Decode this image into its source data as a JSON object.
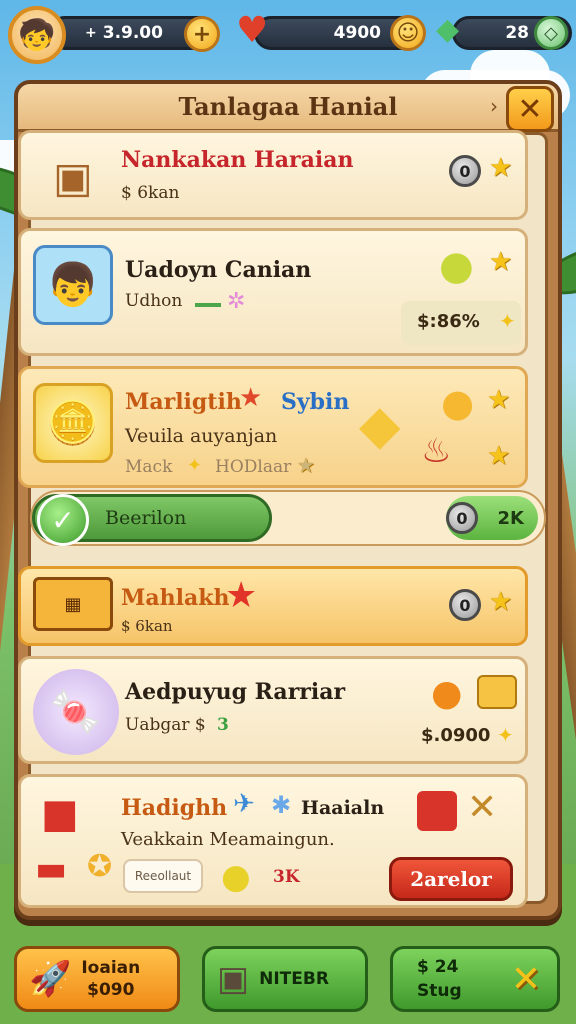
{
  "hud": {
    "coins": "3.9.00",
    "hearts": "4900",
    "gems": "28"
  },
  "panel": {
    "title": "Tanlagaa Hanial"
  },
  "rows": [
    {
      "title": "Nankakan Haraian",
      "sub": "$ 6kan",
      "badge": "0"
    },
    {
      "title": "Uadoyn Canian",
      "sub": "Udhon",
      "price": "$:86%"
    },
    {
      "title": "Marligtih",
      "tag": "Sybin",
      "sub": "Veuila auyanjan",
      "sub2": "Mack",
      "sub3": "HODlaar"
    },
    {
      "title": "Mahlakh",
      "sub": "$ 6kan",
      "badge": "0"
    },
    {
      "title": "Aedpuyug Rarriar",
      "sub": "Uabgar $",
      "sub_tail": "3",
      "price": "$.0900"
    },
    {
      "title": "Hadighh",
      "tag": "Haaialn",
      "sub": "Veakkain Meamaingun.",
      "ghost": "Reeollaut",
      "extra": "3K",
      "action": "2arelor"
    }
  ],
  "progress": {
    "label": "Beerilon",
    "badge": "0",
    "chip": "2K"
  },
  "bottom": {
    "left_line1": "Ioaian",
    "left_line2": "$090",
    "mid_label": "NITEBR",
    "right_line1": "$ 24",
    "right_line2": "Stug"
  },
  "icons": {
    "avatar": "avatar-icon",
    "coin": "coin-icon",
    "heart": "heart-icon",
    "gem": "gem-icon",
    "close": "close-icon",
    "star": "star-icon",
    "check": "check-icon",
    "rocket": "rocket-icon",
    "chest": "chest-icon"
  },
  "colors": {
    "panel_wood": "#b9804a",
    "panel_inner": "#f2e4c7",
    "title_red": "#c6262b",
    "accent_orange": "#f39a1b",
    "accent_green": "#4e9a3a"
  }
}
